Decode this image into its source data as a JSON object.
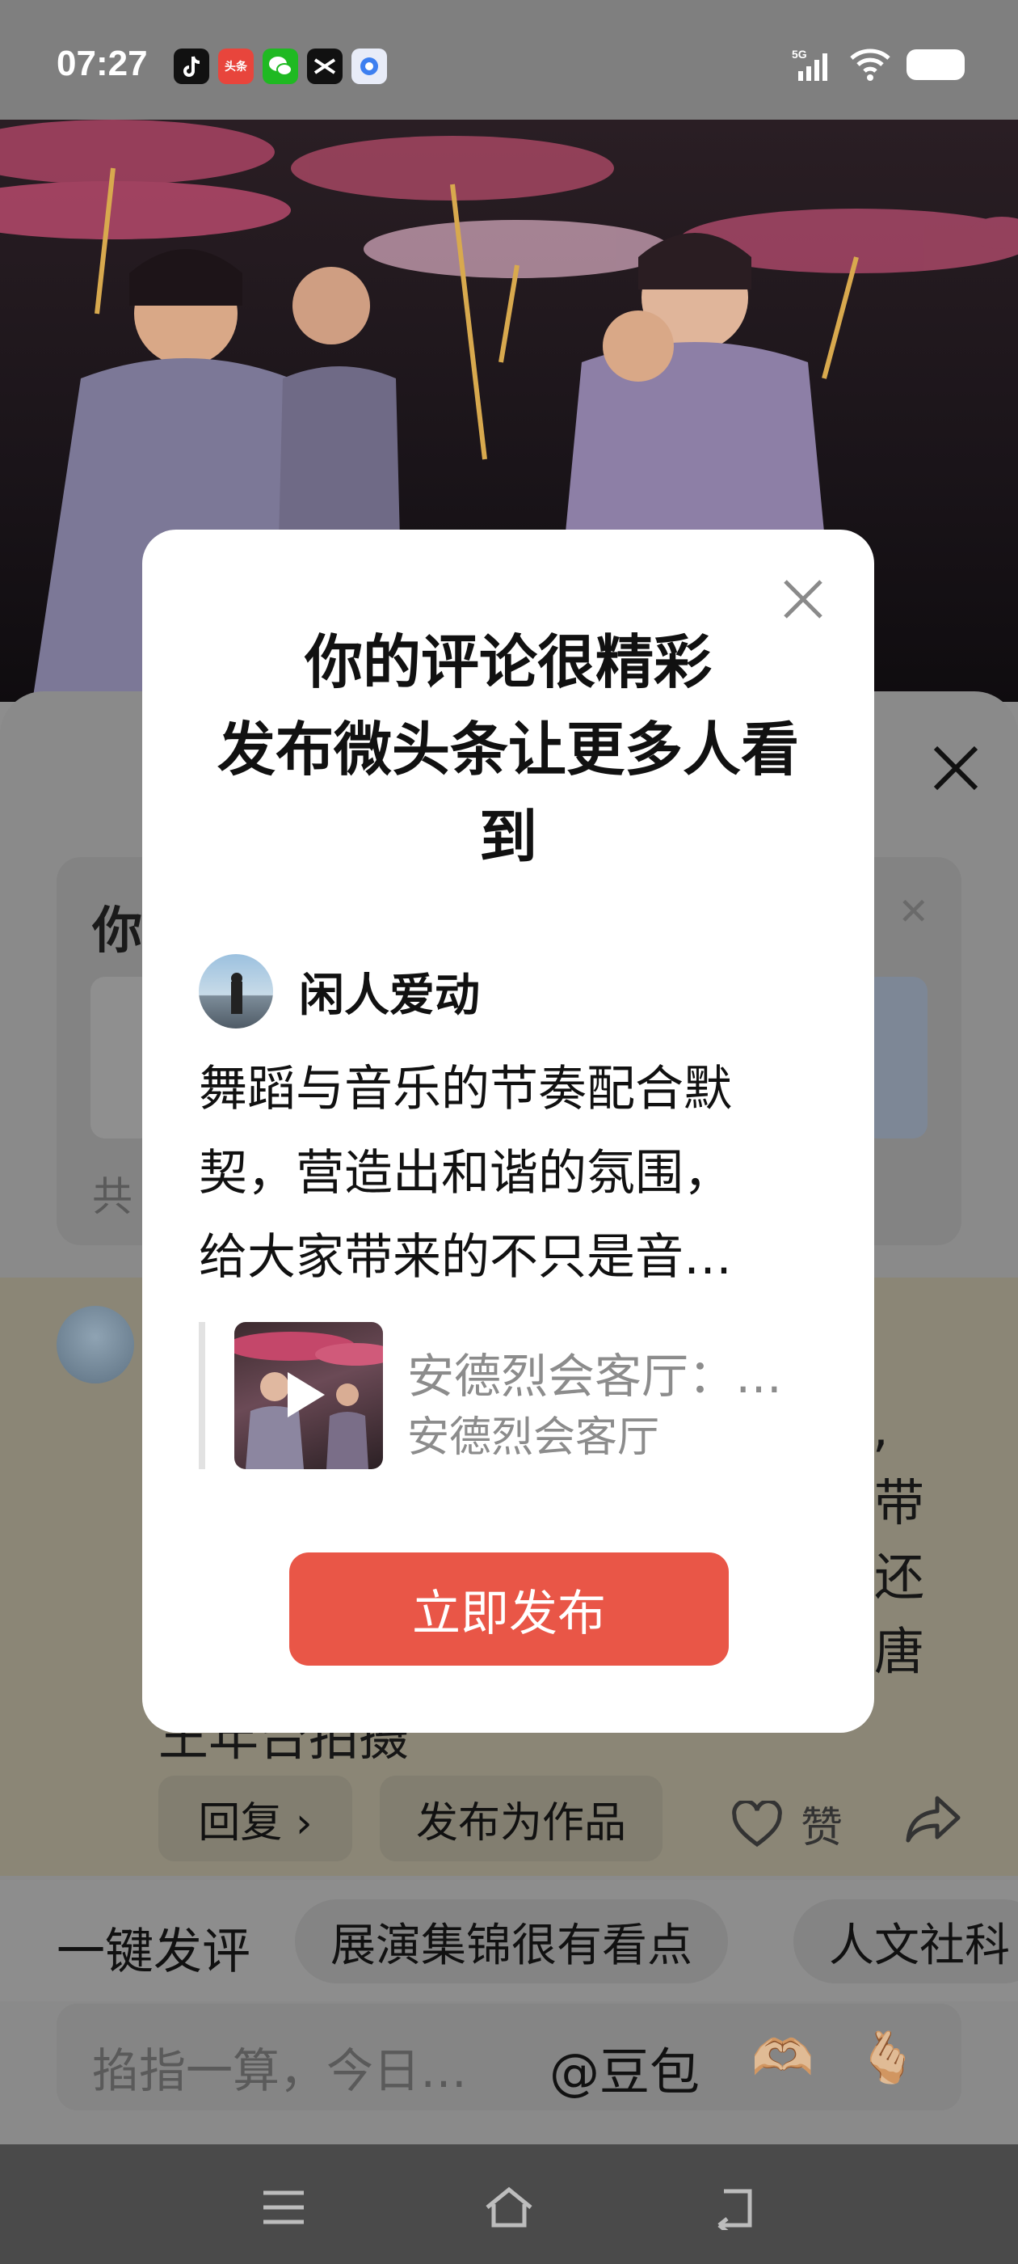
{
  "status_bar": {
    "time": "07:27",
    "notification_icons": [
      "tiktok-icon",
      "toutiao-icon",
      "wechat-icon",
      "capcut-icon",
      "browser-icon"
    ],
    "network": "5G",
    "toutiao_badge": "头条"
  },
  "sheet": {
    "card_title": "你",
    "card_footer": "共",
    "comment_fragments": [
      ",",
      "带",
      "还",
      "唐"
    ],
    "comment_tail": "王年台拍摄",
    "reply_label": "回复 ›",
    "publish_as_work_label": "发布为作品",
    "like_label": "赞"
  },
  "quick_comments": {
    "lead": "一键发评",
    "chips": [
      "展演集锦很有看点",
      "人文社科"
    ]
  },
  "input": {
    "placeholder": "掐指一算，今日…",
    "mention": "@豆包",
    "emojis": [
      "🫶🏼",
      "🫰🏼"
    ]
  },
  "dialog": {
    "title_lines": [
      "你的评论很精彩",
      "发布微头条让更多人看",
      "到"
    ],
    "author_name": "闲人爱动",
    "body_lines": [
      "舞蹈与音乐的节奏配合默",
      "契，营造出和谐的氛围，",
      "给大家带来的不只是音…"
    ],
    "ref_title": "安德烈会客厅：…",
    "ref_subtitle": "安德烈会客厅",
    "publish_label": "立即发布"
  },
  "colors": {
    "accent": "#e95647",
    "dim_overlay": "#8d8d8d",
    "nav_bar": "#4a4a4a"
  }
}
